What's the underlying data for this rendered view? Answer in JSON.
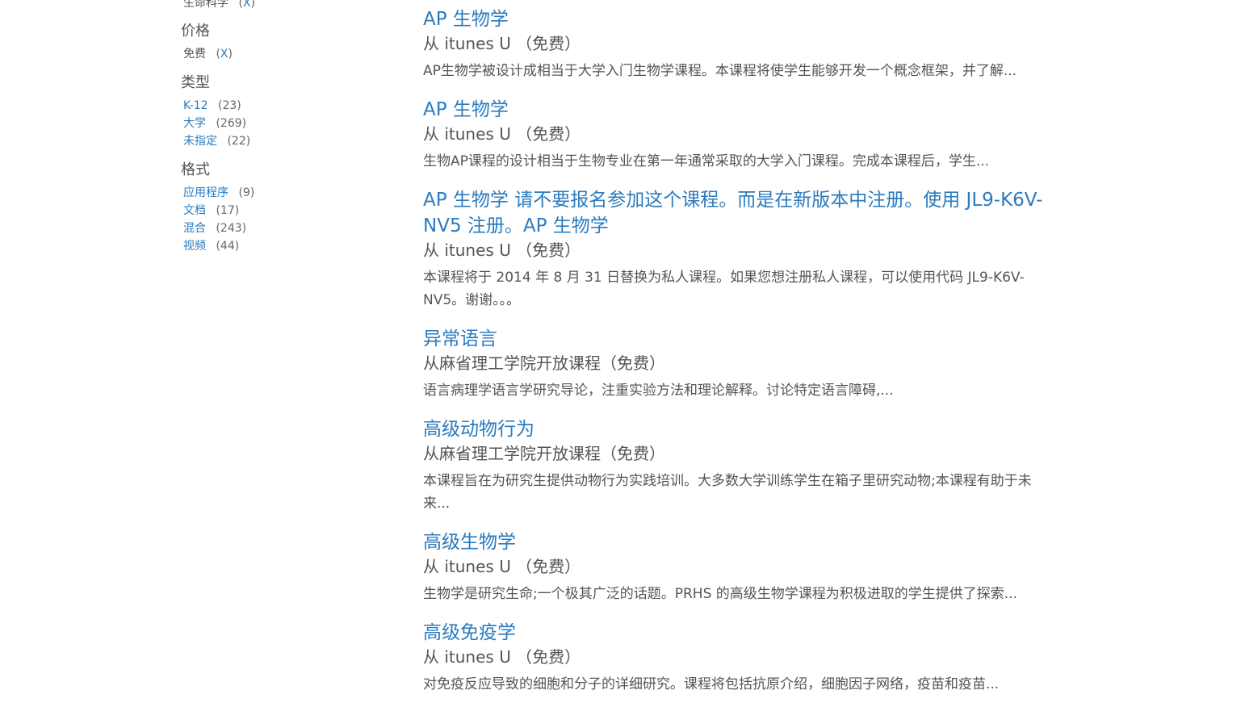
{
  "sidebar": {
    "subject_group": {
      "items": [
        {
          "label": "生命科学",
          "remove": "X"
        }
      ]
    },
    "price_group": {
      "heading": "价格",
      "items": [
        {
          "label": "免费",
          "remove": "X"
        }
      ]
    },
    "type_group": {
      "heading": "类型",
      "items": [
        {
          "label": "K-12",
          "count": "(23)"
        },
        {
          "label": "大学",
          "count": "(269)"
        },
        {
          "label": "未指定",
          "count": "(22)"
        }
      ]
    },
    "format_group": {
      "heading": "格式",
      "items": [
        {
          "label": "应用程序",
          "count": "(9)"
        },
        {
          "label": "文档",
          "count": "(17)"
        },
        {
          "label": "混合",
          "count": "(243)"
        },
        {
          "label": "视频",
          "count": "(44)"
        }
      ]
    }
  },
  "results": [
    {
      "title": "AP 生物学",
      "source": "从 itunes U （免费）",
      "description": "AP生物学被设计成相当于大学入门生物学课程。本课程将使学生能够开发一个概念框架，并了解..."
    },
    {
      "title": "AP 生物学",
      "source": "从 itunes U （免费）",
      "description": "生物AP课程的设计相当于生物专业在第一年通常采取的大学入门课程。完成本课程后，学生..."
    },
    {
      "title": "AP 生物学 请不要报名参加这个课程。而是在新版本中注册。使用 JL9-K6V-NV5 注册。AP 生物学",
      "source": "从 itunes U （免费）",
      "description": "本课程将于 2014 年 8 月 31 日替换为私人课程。如果您想注册私人课程，可以使用代码 JL9-K6V-NV5。谢谢。。。"
    },
    {
      "title": "异常语言",
      "source": "从麻省理工学院开放课程（免费）",
      "description": "语言病理学语言学研究导论，注重实验方法和理论解释。讨论特定语言障碍,..."
    },
    {
      "title": "高级动物行为",
      "source": "从麻省理工学院开放课程（免费）",
      "description": "本课程旨在为研究生提供动物行为实践培训。大多数大学训练学生在箱子里研究动物;本课程有助于未来..."
    },
    {
      "title": "高级生物学",
      "source": "从 itunes U （免费）",
      "description": "生物学是研究生命;一个极其广泛的话题。PRHS 的高级生物学课程为积极进取的学生提供了探索..."
    },
    {
      "title": "高级免疫学",
      "source": "从 itunes U （免费）",
      "description": "对免疫反应导致的细胞和分子的详细研究。课程将包括抗原介绍，细胞因子网络，疫苗和疫苗..."
    }
  ]
}
